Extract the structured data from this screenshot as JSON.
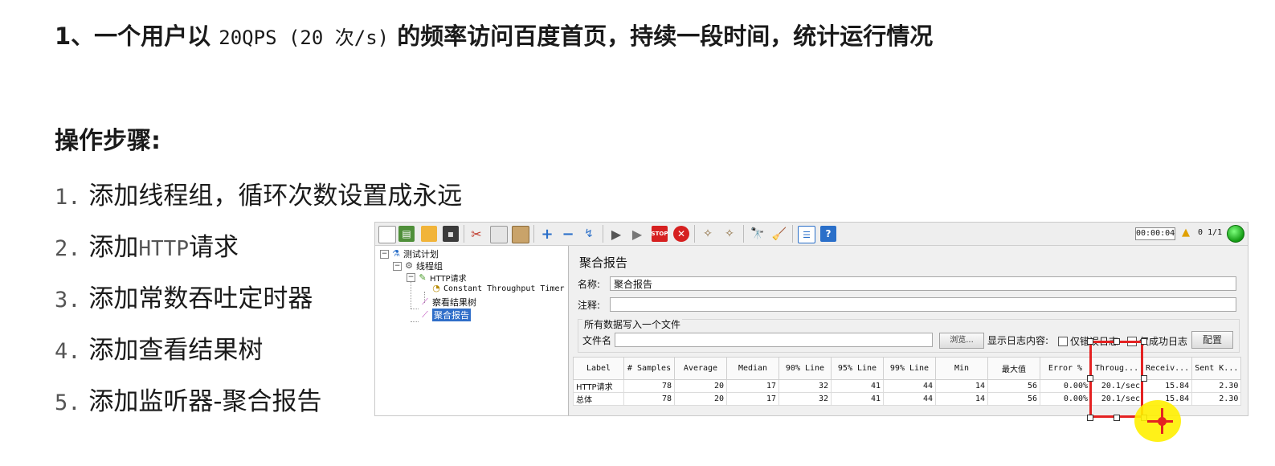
{
  "slide": {
    "heading_prefix": "1、一个用户以 ",
    "heading_mono": "20QPS (20 次/s)",
    "heading_suffix": " 的频率访问百度首页，持续一段时间，统计运行情况",
    "steps_title": "操作步骤:",
    "steps": [
      {
        "num": "1.",
        "text": "添加线程组，循环次数设置成永远"
      },
      {
        "num": "2.",
        "prefix": "添加",
        "mono": "HTTP",
        "suffix": "请求"
      },
      {
        "num": "3.",
        "text": "添加常数吞吐定时器"
      },
      {
        "num": "4.",
        "text": "添加查看结果树"
      },
      {
        "num": "5.",
        "text": "添加监听器-聚合报告"
      }
    ]
  },
  "jmeter": {
    "toolbar": {
      "timer": "00:00:04",
      "warnings": "0",
      "threads": "1/1"
    },
    "tree": {
      "root": "测试计划",
      "thread_group": "线程组",
      "http": "HTTP请求",
      "timer": "Constant Throughput Timer",
      "view_tree": "察看结果树",
      "aggregate": "聚合报告"
    },
    "panel": {
      "title": "聚合报告",
      "name_label": "名称:",
      "name_value": "聚合报告",
      "comment_label": "注释:",
      "file_group": "所有数据写入一个文件",
      "filename_label": "文件名",
      "browse_btn": "浏览...",
      "log_label": "显示日志内容:",
      "errors_only": "仅错误日志",
      "success_only": "仅成功日志",
      "config_btn": "配置"
    },
    "table": {
      "headers": [
        "Label",
        "# Samples",
        "Average",
        "Median",
        "90% Line",
        "95% Line",
        "99% Line",
        "Min",
        "最大值",
        "Error %",
        "Throug...",
        "Receiv...",
        "Sent K..."
      ],
      "rows": [
        [
          "HTTP请求",
          "78",
          "20",
          "17",
          "32",
          "41",
          "44",
          "14",
          "56",
          "0.00%",
          "20.1/sec",
          "15.84",
          "2.30"
        ],
        [
          "总体",
          "78",
          "20",
          "17",
          "32",
          "41",
          "44",
          "14",
          "56",
          "0.00%",
          "20.1/sec",
          "15.84",
          "2.30"
        ]
      ]
    }
  },
  "colors": {
    "highlight": "#e42222",
    "cursor": "#ffef00",
    "selection": "#2f6ec9"
  }
}
